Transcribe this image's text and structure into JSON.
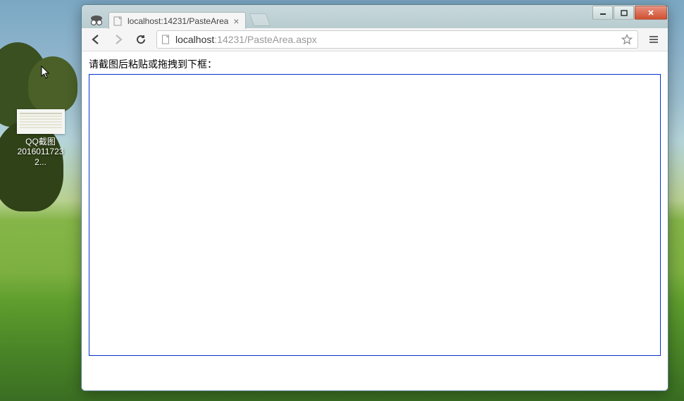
{
  "desktop": {
    "icon": {
      "label_line1": "QQ截图",
      "label_line2": "20160117232..."
    }
  },
  "browser": {
    "tab": {
      "title": "localhost:14231/PasteArea"
    },
    "address": {
      "host": "localhost",
      "port_path": ":14231/PasteArea.aspx"
    },
    "page": {
      "instruction": "请截图后粘贴或拖拽到下框："
    }
  }
}
